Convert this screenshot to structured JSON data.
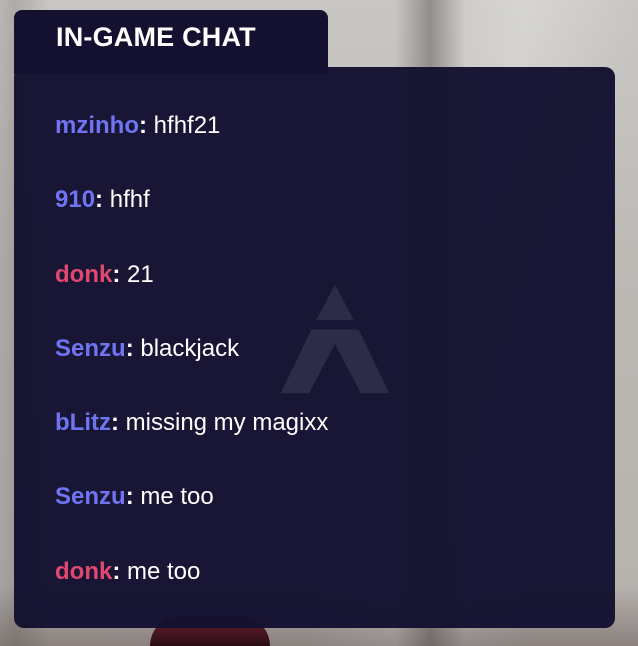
{
  "chat": {
    "title": "IN-GAME CHAT",
    "colors": {
      "panel_bg": "#13112f",
      "team_blue": "#6f74f2",
      "team_red": "#e0486f",
      "text": "#ffffff"
    },
    "messages": [
      {
        "user": "mzinho",
        "team": "blue",
        "text": "hfhf21"
      },
      {
        "user": "910",
        "team": "blue",
        "text": "hfhf"
      },
      {
        "user": "donk",
        "team": "red",
        "text": "21"
      },
      {
        "user": "Senzu",
        "team": "blue",
        "text": "blackjack"
      },
      {
        "user": "bLitz",
        "team": "blue",
        "text": "missing my magixx"
      },
      {
        "user": "Senzu",
        "team": "blue",
        "text": "me too"
      },
      {
        "user": "donk",
        "team": "red",
        "text": "me too"
      }
    ]
  }
}
